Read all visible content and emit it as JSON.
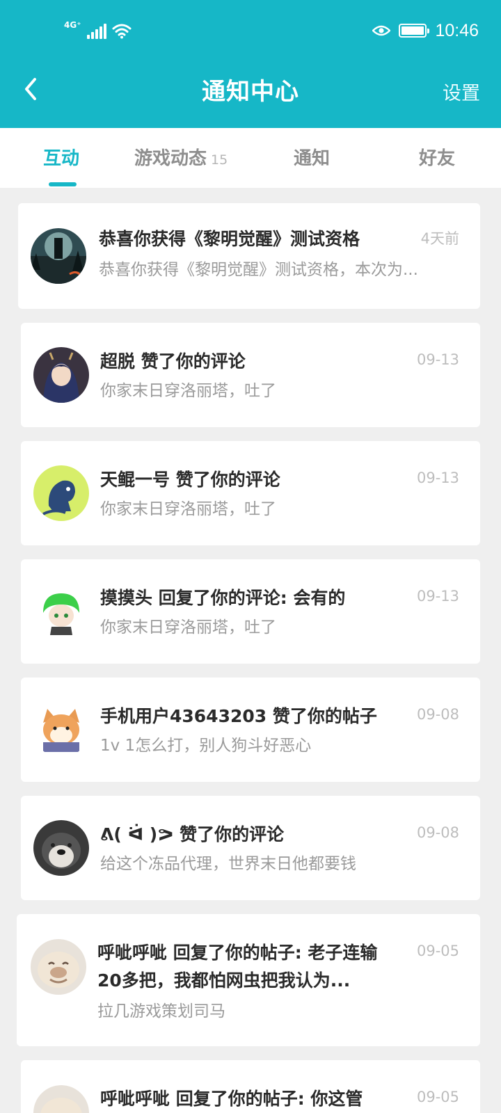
{
  "status_bar": {
    "network": "4G⁺",
    "time": "10:46"
  },
  "header": {
    "title": "通知中心",
    "settings_label": "设置"
  },
  "tabs": [
    {
      "label": "互动",
      "badge": ""
    },
    {
      "label": "游戏动态",
      "badge": "15"
    },
    {
      "label": "通知",
      "badge": ""
    },
    {
      "label": "好友",
      "badge": ""
    }
  ],
  "notifications": [
    {
      "title": "恭喜你获得《黎明觉醒》测试资格",
      "subtitle": "恭喜你获得《黎明觉醒》测试资格，本次为...",
      "time": "4天前",
      "avatar": "forest-silhouette-avatar"
    },
    {
      "title": "超脱 赞了你的评论",
      "subtitle": "你家末日穿洛丽塔，吐了",
      "time": "09-13",
      "avatar": "anime-girl-avatar"
    },
    {
      "title": "天鲲一号 赞了你的评论",
      "subtitle": "你家末日穿洛丽塔，吐了",
      "time": "09-13",
      "avatar": "blue-dragon-avatar"
    },
    {
      "title": "摸摸头 回复了你的评论: 会有的",
      "subtitle": "你家末日穿洛丽塔，吐了",
      "time": "09-13",
      "avatar": "green-hair-chibi-avatar"
    },
    {
      "title": "手机用户43643203 赞了你的帖子",
      "subtitle": "1v 1怎么打，别人狗斗好恶心",
      "time": "09-08",
      "avatar": "shiba-dog-avatar"
    },
    {
      "title": "ᕕ( ᐛ )ᕗ 赞了你的评论",
      "subtitle": "给这个冻品代理，世界末日他都要钱",
      "time": "09-08",
      "avatar": "husky-avatar"
    },
    {
      "title": "呼呲呼呲 回复了你的帖子: 老子连输20多把，我都怕网虫把我认为...",
      "subtitle": "拉几游戏策划司马",
      "time": "09-05",
      "avatar": "bulldog-avatar"
    },
    {
      "title": "呼呲呼呲 回复了你的帖子: 你这管",
      "subtitle": "",
      "time": "09-05",
      "avatar": "bulldog-avatar"
    }
  ],
  "colors": {
    "accent": "#16b7c7",
    "background": "#efefef"
  }
}
